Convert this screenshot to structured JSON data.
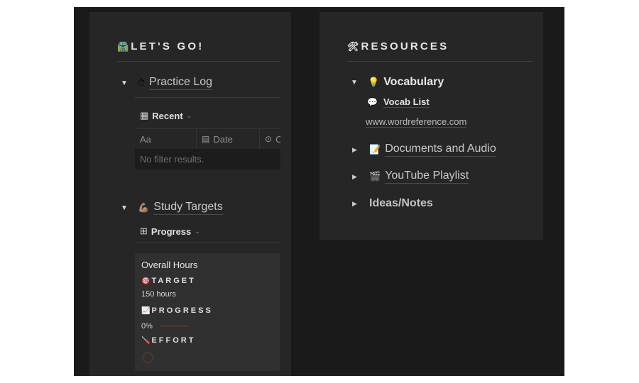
{
  "left_column": {
    "heading": {
      "emoji": "🛣️",
      "label": "LET'S GO!"
    },
    "practice_log": {
      "emoji": "⏱",
      "title": "Practice Log",
      "view": {
        "icon": "table-icon",
        "label": "Recent"
      },
      "columns": [
        {
          "icon": "",
          "label": "Aa"
        },
        {
          "icon": "calendar-icon",
          "label": "Date"
        },
        {
          "icon": "select-icon",
          "label": "C"
        }
      ],
      "empty_message": "No filter results."
    },
    "study_targets": {
      "emoji": "💪🏽",
      "title": "Study Targets",
      "view": {
        "icon": "gallery-icon",
        "label": "Progress"
      },
      "card": {
        "title": "Overall Hours",
        "target_label": "TARGET",
        "target_emoji": "🎯",
        "target_value": "150 hours",
        "progress_label": "PROGRESS",
        "progress_emoji": "📈",
        "progress_value": "0%",
        "progress_fraction": 0,
        "effort_label": "EFFORT",
        "effort_emoji": "🪛"
      }
    }
  },
  "right_column": {
    "heading": {
      "emoji": "🛠",
      "label": "RESOURCES"
    },
    "vocabulary": {
      "emoji": "💡",
      "title": "Vocabulary",
      "expanded": true,
      "items": [
        {
          "emoji": "💬",
          "label": "Vocab List"
        }
      ],
      "url": "www.wordreference.com"
    },
    "toggles": [
      {
        "emoji": "📝",
        "label": "Documents and Audio"
      },
      {
        "emoji": "🎬",
        "label": "YouTube Playlist"
      },
      {
        "emoji": "",
        "label": "Ideas/Notes"
      }
    ]
  },
  "icons": {
    "triangle_open": "▼",
    "triangle_closed": "▶",
    "chevron": "⌄",
    "table": "▦",
    "gallery": "⊞",
    "calendar": "▤",
    "select": "⊙"
  }
}
